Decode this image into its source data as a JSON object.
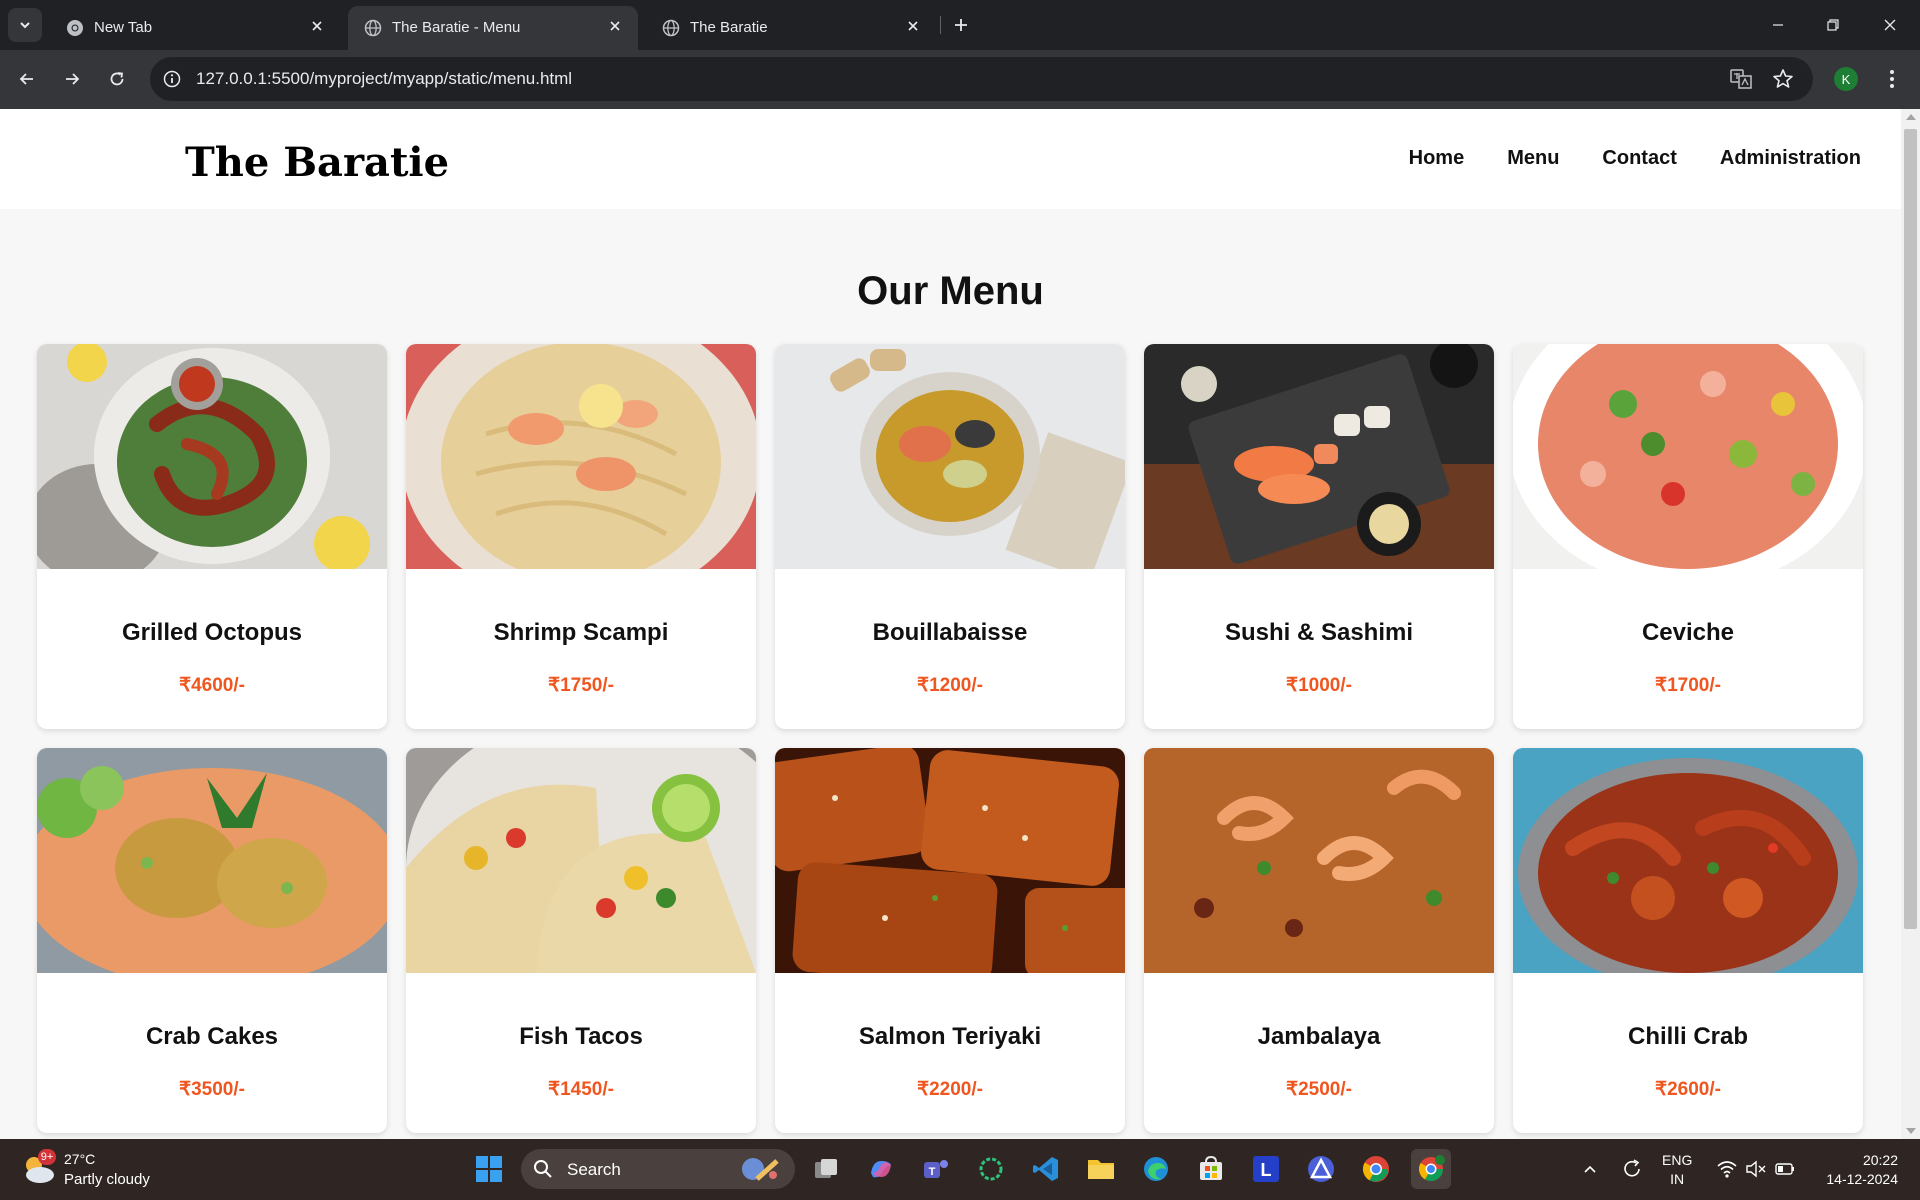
{
  "browser": {
    "tabs": [
      {
        "title": "New Tab",
        "active": false
      },
      {
        "title": "The Baratie - Menu",
        "active": true
      },
      {
        "title": "The Baratie",
        "active": false
      }
    ],
    "url": "127.0.0.1:5500/myproject/myapp/static/menu.html",
    "profile_initial": "K"
  },
  "site": {
    "brand": "The Baratie",
    "nav": [
      "Home",
      "Menu",
      "Contact",
      "Administration"
    ],
    "section_title": "Our Menu"
  },
  "menu": [
    {
      "name": "Grilled Octopus",
      "price": "₹4600/-",
      "image": "grilled-octopus"
    },
    {
      "name": "Shrimp Scampi",
      "price": "₹1750/-",
      "image": "shrimp-scampi"
    },
    {
      "name": "Bouillabaisse",
      "price": "₹1200/-",
      "image": "bouillabaisse"
    },
    {
      "name": "Sushi & Sashimi",
      "price": "₹1000/-",
      "image": "sushi-sashimi"
    },
    {
      "name": "Ceviche",
      "price": "₹1700/-",
      "image": "ceviche"
    },
    {
      "name": "Crab Cakes",
      "price": "₹3500/-",
      "image": "crab-cakes"
    },
    {
      "name": "Fish Tacos",
      "price": "₹1450/-",
      "image": "fish-tacos"
    },
    {
      "name": "Salmon Teriyaki",
      "price": "₹2200/-",
      "image": "salmon-teriyaki"
    },
    {
      "name": "Jambalaya",
      "price": "₹2500/-",
      "image": "jambalaya"
    },
    {
      "name": "Chilli Crab",
      "price": "₹2600/-",
      "image": "chilli-crab"
    }
  ],
  "taskbar": {
    "weather_temp": "27°C",
    "weather_condition": "Partly cloudy",
    "weather_badge": "9+",
    "search_label": "Search",
    "lang_top": "ENG",
    "lang_bottom": "IN",
    "time": "20:22",
    "date": "14-12-2024"
  },
  "colors": {
    "price": "#f0561f",
    "chrome_dark": "#202124",
    "chrome_mid": "#35363a",
    "taskbar": "#2f2623"
  }
}
